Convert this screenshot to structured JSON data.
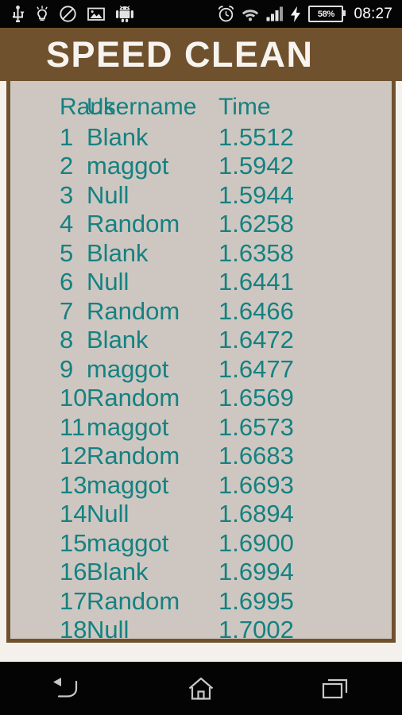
{
  "status_bar": {
    "left_icons": [
      {
        "name": "usb-icon",
        "label": "USB"
      },
      {
        "name": "lightbulb-icon",
        "label": "Tip"
      },
      {
        "name": "do-not-disturb-icon",
        "label": "Do not disturb"
      },
      {
        "name": "screenshot-image-icon",
        "label": "Screenshot"
      },
      {
        "name": "android-icon",
        "label": "Android"
      }
    ],
    "right_icons": [
      {
        "name": "alarm-clock-icon",
        "label": "Alarm"
      },
      {
        "name": "wifi-icon",
        "label": "Wi-Fi"
      },
      {
        "name": "signal-bars-icon",
        "label": "Signal"
      },
      {
        "name": "charging-bolt-icon",
        "label": "Charging"
      }
    ],
    "battery_percent": "58%",
    "time": "08:27"
  },
  "title_bar": {
    "app_title": "SPEED CLEAN"
  },
  "leaderboard": {
    "columns": [
      "Rank",
      "Username",
      "Time"
    ],
    "rows": [
      {
        "rank": "1",
        "username": "Blank",
        "time": "1.5512"
      },
      {
        "rank": "2",
        "username": "maggot",
        "time": "1.5942"
      },
      {
        "rank": "3",
        "username": "Null",
        "time": "1.5944"
      },
      {
        "rank": "4",
        "username": "Random",
        "time": "1.6258"
      },
      {
        "rank": "5",
        "username": "Blank",
        "time": "1.6358"
      },
      {
        "rank": "6",
        "username": "Null",
        "time": "1.6441"
      },
      {
        "rank": "7",
        "username": "Random",
        "time": "1.6466"
      },
      {
        "rank": "8",
        "username": "Blank",
        "time": "1.6472"
      },
      {
        "rank": "9",
        "username": "maggot",
        "time": "1.6477"
      },
      {
        "rank": "10",
        "username": "Random",
        "time": "1.6569"
      },
      {
        "rank": "11",
        "username": "maggot",
        "time": "1.6573"
      },
      {
        "rank": "12",
        "username": "Random",
        "time": "1.6683"
      },
      {
        "rank": "13",
        "username": "maggot",
        "time": "1.6693"
      },
      {
        "rank": "14",
        "username": "Null",
        "time": "1.6894"
      },
      {
        "rank": "15",
        "username": "maggot",
        "time": "1.6900"
      },
      {
        "rank": "16",
        "username": "Blank",
        "time": "1.6994"
      },
      {
        "rank": "17",
        "username": "Random",
        "time": "1.6995"
      },
      {
        "rank": "18",
        "username": "Null",
        "time": "1.7002"
      }
    ]
  },
  "nav_bar": {
    "buttons": [
      {
        "name": "back-button",
        "label": "Back"
      },
      {
        "name": "home-button",
        "label": "Home"
      },
      {
        "name": "recents-button",
        "label": "Recent apps"
      }
    ]
  },
  "colors": {
    "brand_brown": "#70512E",
    "content_bg": "#CEC7C1",
    "accent_teal": "#158181",
    "page_bg": "#F4F1EC"
  }
}
